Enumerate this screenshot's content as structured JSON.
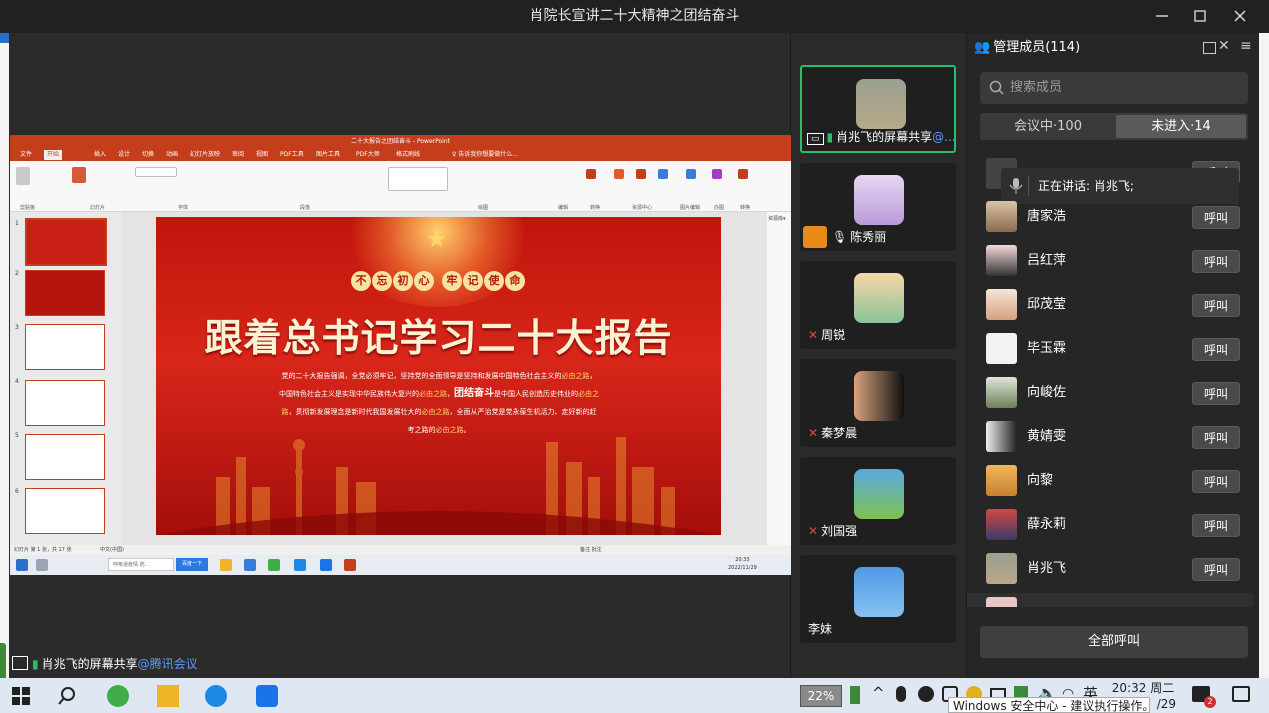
{
  "window": {
    "title": "肖院长宣讲二十大精神之团结奋斗",
    "minimize_icon": "minimize-icon",
    "maximize_icon": "maximize-icon",
    "close_icon": "close-icon"
  },
  "share": {
    "label_name": "肖兆飞的屏幕共享",
    "label_app": "@腾讯会议"
  },
  "ppt": {
    "title": "二十大报告之团结奋斗 - PowerPoint",
    "tabs": [
      "文件",
      "开始",
      "插入",
      "设计",
      "切换",
      "动画",
      "幻灯片放映",
      "审阅",
      "视图",
      "PDF工具",
      "图片工具",
      "PDF大师",
      "格式刷线",
      "♀ 告诉我你想要做什么..."
    ],
    "ribbon_groups": [
      "剪贴板",
      "幻灯片",
      "字体",
      "段落",
      "绘图",
      "编辑",
      "转换",
      "资源中心",
      "图片编辑",
      "办图",
      "转换"
    ],
    "slide_numbers": [
      "1",
      "2",
      "3",
      "4",
      "5",
      "6"
    ],
    "slide": {
      "badges": [
        "不",
        "忘",
        "初",
        "心",
        "牢",
        "记",
        "使",
        "命"
      ],
      "headline": "跟着总书记学习二十大报告",
      "body_lines": [
        [
          "党的二十大报告强调，全党必须牢记，坚持党的全面领导是坚持和发展中国特色社会主义的",
          "必由之路",
          "，"
        ],
        [
          "中国特色社会主义是实现中华民族伟大复兴的",
          "必由之路",
          "，",
          "团结奋斗",
          "是中国人民创造历史伟业的",
          "必由之"
        ],
        [
          "路",
          "，贯彻新发展理念是新时代我国发展壮大的",
          "必由之路",
          "，全面从严治党是党永葆生机活力、走好新的赶"
        ],
        [
          "考之路的",
          "必由之路",
          "。"
        ]
      ]
    },
    "right_pane_label": "资源库▾",
    "status_left": "幻灯片 第 1 张，共 17 张",
    "status_lang": "中文(中国)",
    "status_right": "备注  批注",
    "search_placeholder": "呼吸道疫情 药...",
    "search_button": "百度一下",
    "clock_time": "20:33",
    "clock_date": "2022/11/29"
  },
  "videos": [
    {
      "name": "肖兆飞的屏幕共享",
      "suffix": "@...",
      "active": true
    },
    {
      "name": "陈秀丽",
      "suffix": ""
    },
    {
      "name": "周锐",
      "suffix": ""
    },
    {
      "name": "秦梦晨",
      "suffix": ""
    },
    {
      "name": "刘国强",
      "suffix": ""
    },
    {
      "name": "李妹",
      "suffix": ""
    }
  ],
  "panel": {
    "title": "管理成员(114)",
    "search_placeholder": "搜索成员",
    "tab_in_meeting": "会议中·100",
    "tab_not_joined": "未进入·14",
    "speaking": "正在讲话: 肖兆飞;",
    "call_label": "呼叫",
    "members": [
      "唐家浩",
      "吕红萍",
      "邱茂莹",
      "毕玉霖",
      "向峻佐",
      "黄婧雯",
      "向黎",
      "薛永莉",
      "肖兆飞"
    ],
    "call_all": "全部呼叫"
  },
  "taskbar": {
    "battery": "22%",
    "ime": "英",
    "time": "20:32 周二",
    "date_partial": "/29",
    "toast": "Windows 安全中心 - 建议执行操作。",
    "notification_count": "2"
  },
  "colors": {
    "ppt_red": "#c43e1c",
    "active_green": "#2bbd6a",
    "link_blue": "#5a9ef8"
  }
}
